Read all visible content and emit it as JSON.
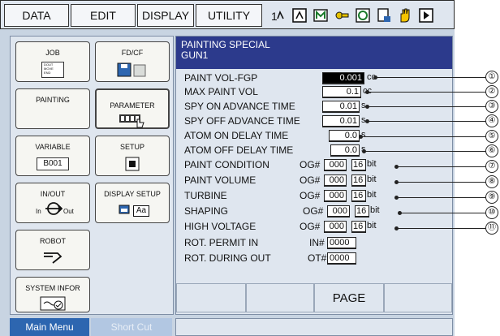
{
  "menubar": {
    "items": [
      "DATA",
      "EDIT",
      "DISPLAY",
      "UTILITY"
    ],
    "status_icons": [
      "axis-order-icon",
      "manual-speed-icon",
      "security-icon",
      "tool-icon",
      "cycle-icon",
      "page-icon",
      "hand-icon",
      "play-icon"
    ]
  },
  "mainmenu": {
    "tiles": [
      {
        "label": "JOB",
        "sub": [
          "DOUT",
          "MOVE",
          "END"
        ]
      },
      {
        "label": "FD/CF"
      },
      {
        "label": "PAINTING"
      },
      {
        "label": "PARAMETER"
      },
      {
        "label": "VARIABLE",
        "value": "B001"
      },
      {
        "label": "SETUP"
      },
      {
        "label": "IN/OUT",
        "in": "In",
        "out": "Out"
      },
      {
        "label": "DISPLAY SETUP",
        "sub": "Aa"
      },
      {
        "label": "ROBOT"
      },
      {
        "label": "SYSTEM INFOR"
      }
    ]
  },
  "content": {
    "title_line1": "PAINTING SPECIAL",
    "title_line2": "GUN1",
    "rows": [
      {
        "label": "PAINT VOL-FGP",
        "value": "0.001",
        "unit": "cc",
        "selected": true
      },
      {
        "label": "MAX PAINT VOL",
        "value": "0.1",
        "unit": "cc"
      },
      {
        "label": "SPY ON ADVANCE TIME",
        "value": "0.01",
        "unit": "s"
      },
      {
        "label": "SPY OFF ADVANCE TIME",
        "value": "0.01",
        "unit": "s"
      },
      {
        "label": "ATOM ON DELAY TIME",
        "value": "0.0",
        "unit": "s"
      },
      {
        "label": "ATOM OFF DELAY TIME",
        "value": "0.0",
        "unit": "s"
      }
    ],
    "io_rows": [
      {
        "label": "PAINT CONDITION",
        "prefix": "OG#",
        "value": "000",
        "bits": "16",
        "unit": "bit"
      },
      {
        "label": "PAINT VOLUME",
        "prefix": "OG#",
        "value": "000",
        "bits": "16",
        "unit": "bit"
      },
      {
        "label": "TURBINE",
        "prefix": "OG#",
        "value": "000",
        "bits": "16",
        "unit": "bit"
      },
      {
        "label": "SHAPING",
        "prefix": "OG#",
        "value": "000",
        "bits": "16",
        "unit": "bit"
      },
      {
        "label": "HIGH VOLTAGE",
        "prefix": "OG#",
        "value": "000",
        "bits": "16",
        "unit": "bit"
      }
    ],
    "perm_rows": [
      {
        "label": "ROT. PERMIT IN",
        "prefix": "IN#",
        "value": "0000"
      },
      {
        "label": "ROT. DURING OUT",
        "prefix": "OT#",
        "value": "0000"
      }
    ],
    "bottom_buttons": [
      "",
      "",
      "PAGE",
      ""
    ]
  },
  "tabs": {
    "main": "Main Menu",
    "short": "Short Cut"
  },
  "callouts": [
    "①",
    "②",
    "③",
    "④",
    "⑤",
    "⑥",
    "⑦",
    "⑧",
    "⑨",
    "⑩",
    "⑪"
  ]
}
